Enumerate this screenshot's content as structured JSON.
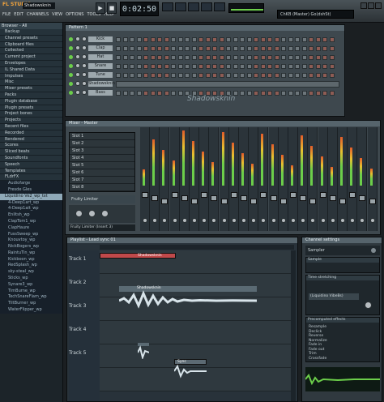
{
  "topbar": {
    "logo": "FL STUDIO",
    "song_name": "Shadowsknin",
    "menu": [
      "FILE",
      "EDIT",
      "CHANNELS",
      "VIEW",
      "OPTIONS",
      "TOOLS",
      "HELP"
    ],
    "time": "0:02:50",
    "hint": "ChKB (Master) Go(dshSt)"
  },
  "browser": {
    "header": "Browser - All",
    "items": [
      {
        "label": "Backup",
        "type": "folder"
      },
      {
        "label": "Channel presets",
        "type": "folder"
      },
      {
        "label": "Clipboard files",
        "type": "folder"
      },
      {
        "label": "Collected",
        "type": "folder"
      },
      {
        "label": "Current project",
        "type": "folder"
      },
      {
        "label": "Envelopes",
        "type": "folder"
      },
      {
        "label": "IL Shared Data",
        "type": "folder"
      },
      {
        "label": "Impulses",
        "type": "folder"
      },
      {
        "label": "Misc",
        "type": "folder"
      },
      {
        "label": "Mixer presets",
        "type": "folder"
      },
      {
        "label": "Packs",
        "type": "folder"
      },
      {
        "label": "Plugin database",
        "type": "folder"
      },
      {
        "label": "Plugin presets",
        "type": "folder"
      },
      {
        "label": "Project bones",
        "type": "folder"
      },
      {
        "label": "Projects",
        "type": "folder"
      },
      {
        "label": "Recent files",
        "type": "folder"
      },
      {
        "label": "Recorded",
        "type": "folder"
      },
      {
        "label": "Rendered",
        "type": "folder"
      },
      {
        "label": "Scores",
        "type": "folder"
      },
      {
        "label": "Sliced beats",
        "type": "folder"
      },
      {
        "label": "Soundfonts",
        "type": "folder"
      },
      {
        "label": "Speech",
        "type": "folder"
      },
      {
        "label": "Templates",
        "type": "folder"
      },
      {
        "label": "FLdrFX",
        "type": "folder"
      },
      {
        "label": "Audiofarge",
        "type": "sub"
      },
      {
        "label": "Fresde Gles",
        "type": "sub"
      },
      {
        "label": "Liquidino Ve2_wp_txt",
        "type": "sel"
      },
      {
        "label": "4-Deep1art_wp",
        "type": "sub"
      },
      {
        "label": "4-Deep1ait_wp",
        "type": "sub"
      },
      {
        "label": "Enlitsh_wp",
        "type": "sub"
      },
      {
        "label": "ClapTom1_wp",
        "type": "sub"
      },
      {
        "label": "ClapHaure",
        "type": "sub"
      },
      {
        "label": "FussSweep_wp",
        "type": "sub"
      },
      {
        "label": "Knouvtoy_wp",
        "type": "sub"
      },
      {
        "label": "NickBogers_wp",
        "type": "sub"
      },
      {
        "label": "RaintuTin_wp",
        "type": "sub"
      },
      {
        "label": "Kickboon_wp",
        "type": "sub"
      },
      {
        "label": "RedSplash_wp",
        "type": "sub"
      },
      {
        "label": "sky-steal_wp",
        "type": "sub"
      },
      {
        "label": "Sticks_wp",
        "type": "sub"
      },
      {
        "label": "Synare3_wp",
        "type": "sub"
      },
      {
        "label": "TimBurne_wp",
        "type": "sub"
      },
      {
        "label": "TechSnareFlam_wp",
        "type": "sub"
      },
      {
        "label": "TiltBurner_wp",
        "type": "sub"
      },
      {
        "label": "WaterFlipper_wp",
        "type": "sub"
      }
    ]
  },
  "step_sequencer": {
    "title": "Pattern 1",
    "channels": [
      "Kick",
      "Clap",
      "Hat",
      "Snare",
      "Tune",
      "Shadowsknin",
      "Bass"
    ],
    "watermark": "Shadowsknin"
  },
  "mixer": {
    "title": "Mixer - Master",
    "fx_slots": [
      "Slot 1",
      "Slot 2",
      "Slot 3",
      "Slot 4",
      "Slot 5",
      "Slot 6",
      "Slot 7",
      "Slot 8"
    ],
    "limiter": "Fruity Limiter",
    "footer": "Fruity Limiter (Insert 3)"
  },
  "playlist": {
    "title": "Playlist - Lead sync 01",
    "pattern_label": "Pattern 1",
    "tracks": [
      "Track 1",
      "Track 2",
      "Track 3",
      "Track 4",
      "Track 5"
    ],
    "clips": [
      {
        "label": "Shadowsknin",
        "track": 0
      },
      {
        "label": "Shadowsknin",
        "track": 1
      },
      {
        "label": "Sync",
        "track": 3
      }
    ]
  },
  "sidepanel": {
    "title": "Channel settings",
    "plugin": "Sampler",
    "sample_label": "(Liquidino VibeBs)",
    "sections": [
      "Sample",
      "Time stretching",
      "Precomputed effects"
    ],
    "options": [
      "Resample",
      "Declick",
      "Reverse",
      "Normalize",
      "Fade in",
      "Fade out",
      "Trim",
      "Crossfade"
    ]
  },
  "colors": {
    "accent_green": "#6cce4a",
    "clip_red": "#c0494a",
    "selection": "#8fa9b8"
  }
}
